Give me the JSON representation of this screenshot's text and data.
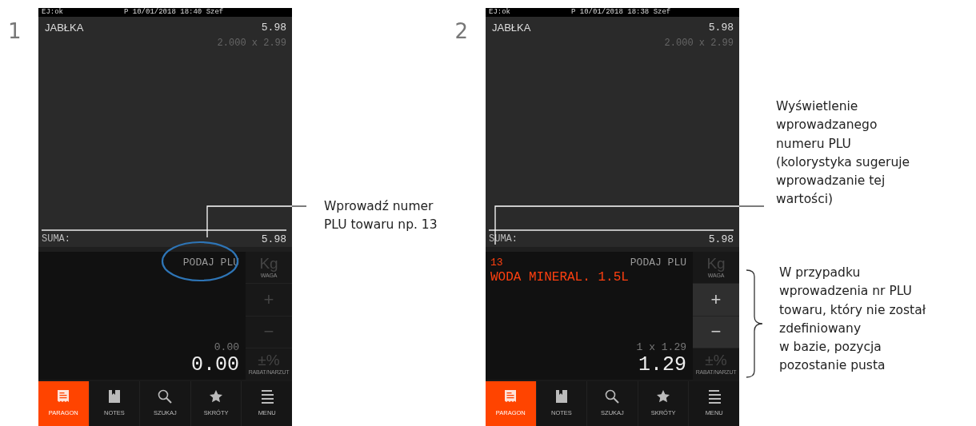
{
  "panels": [
    {
      "number": "1",
      "status_bar": {
        "left": "EJ:ok",
        "center": "P 10/01/2018 18:40 Szef"
      },
      "receipt": {
        "items": [
          {
            "name": "JABŁKA",
            "amount": "5.98",
            "detail": "2.000 x 2.99"
          }
        ],
        "total_label": "SUMA:",
        "total": "5.98"
      },
      "entry": {
        "prompt": "PODAJ PLU",
        "detail": "0.00",
        "amount": "0.00"
      },
      "side_buttons": [
        {
          "kind": "weight",
          "label": "Kg",
          "caption": "WAGA",
          "disabled": true
        },
        {
          "kind": "plus",
          "label": "+",
          "disabled": true
        },
        {
          "kind": "minus",
          "label": "−",
          "disabled": true
        },
        {
          "kind": "discount",
          "label": "±%",
          "caption": "RABAT/NARZUT",
          "disabled": true
        }
      ],
      "nav": [
        {
          "kind": "receipt",
          "label": "PARAGON",
          "selected": true
        },
        {
          "kind": "notes",
          "label": "NOTES",
          "selected": false
        },
        {
          "kind": "search",
          "label": "SZUKAJ",
          "selected": false
        },
        {
          "kind": "star",
          "label": "SKRÓTY",
          "selected": false
        },
        {
          "kind": "menu",
          "label": "MENU",
          "selected": false
        }
      ]
    },
    {
      "number": "2",
      "status_bar": {
        "left": "EJ:ok",
        "center": "P 10/01/2018 18:38 Szef"
      },
      "receipt": {
        "items": [
          {
            "name": "JABŁKA",
            "amount": "5.98",
            "detail": "2.000 x 2.99"
          }
        ],
        "total_label": "SUMA:",
        "total": "5.98"
      },
      "entry": {
        "plu": "13",
        "prompt": "PODAJ PLU",
        "product": "WODA MINERAL. 1.5L",
        "detail": "1 x 1.29",
        "amount": "1.29"
      },
      "side_buttons": [
        {
          "kind": "weight",
          "label": "Kg",
          "caption": "WAGA",
          "disabled": true
        },
        {
          "kind": "plus",
          "label": "+",
          "disabled": false
        },
        {
          "kind": "minus",
          "label": "−",
          "disabled": false
        },
        {
          "kind": "discount",
          "label": "±%",
          "caption": "RABAT/NARZUT",
          "disabled": true
        }
      ],
      "nav": [
        {
          "kind": "receipt",
          "label": "PARAGON",
          "selected": true
        },
        {
          "kind": "notes",
          "label": "NOTES",
          "selected": false
        },
        {
          "kind": "search",
          "label": "SZUKAJ",
          "selected": false
        },
        {
          "kind": "star",
          "label": "SKRÓTY",
          "selected": false
        },
        {
          "kind": "menu",
          "label": "MENU",
          "selected": false
        }
      ]
    }
  ],
  "annotations": [
    {
      "kind": "plu-input",
      "text": "Wprowadź numer\nPLU towaru np. 13"
    },
    {
      "kind": "plu-display",
      "text": "Wyświetlenie\nwprowadzanego\nnumeru PLU\n(kolorystyka sugeruje\nwprowadzanie tej\nwartości)"
    },
    {
      "kind": "undefined-plu",
      "text": "W przypadku\nwprowadzenia nr PLU\ntowaru, który nie został\nzdefiniowany\nw bazie, pozycja\npozostanie pusta"
    }
  ]
}
